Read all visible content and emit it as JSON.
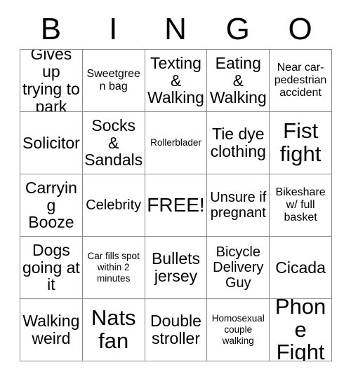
{
  "card": {
    "type": "bingo-card",
    "header_letters": [
      "B",
      "I",
      "N",
      "G",
      "O"
    ],
    "columns": 5,
    "rows": 5,
    "free_space_index": 12,
    "colors": {
      "background": "#ffffff",
      "text": "#000000",
      "grid_line": "#8a8a8a"
    },
    "squares": [
      {
        "text": "Gives up trying to park",
        "size": "md"
      },
      {
        "text": "Sweetgreen bag",
        "size": "xs"
      },
      {
        "text": "Texting & Walking",
        "size": "md"
      },
      {
        "text": "Eating & Walking",
        "size": "md"
      },
      {
        "text": "Near car-pedestrian accident",
        "size": "xs"
      },
      {
        "text": "Solicitor",
        "size": "md"
      },
      {
        "text": "Socks & Sandals",
        "size": "md"
      },
      {
        "text": "Rollerblader",
        "size": "xxs"
      },
      {
        "text": "Tie dye clothing",
        "size": "md"
      },
      {
        "text": "Fist fight",
        "size": "xl"
      },
      {
        "text": "Carrying Booze",
        "size": "md"
      },
      {
        "text": "Celebrity",
        "size": "sm"
      },
      {
        "text": "FREE!",
        "size": "lg"
      },
      {
        "text": "Unsure if pregnant",
        "size": "sm"
      },
      {
        "text": "Bikeshare w/ full basket",
        "size": "xs"
      },
      {
        "text": "Dogs going at it",
        "size": "md"
      },
      {
        "text": "Car fills spot within 2 minutes",
        "size": "xxs"
      },
      {
        "text": "Bullets jersey",
        "size": "md"
      },
      {
        "text": "Bicycle Delivery Guy",
        "size": "sm"
      },
      {
        "text": "Cicada",
        "size": "md"
      },
      {
        "text": "Walking weird",
        "size": "md"
      },
      {
        "text": "Nats fan",
        "size": "xl"
      },
      {
        "text": "Double stroller",
        "size": "md"
      },
      {
        "text": "Homosexual couple walking",
        "size": "xxs"
      },
      {
        "text": "Phone Fight",
        "size": "xl"
      }
    ]
  }
}
